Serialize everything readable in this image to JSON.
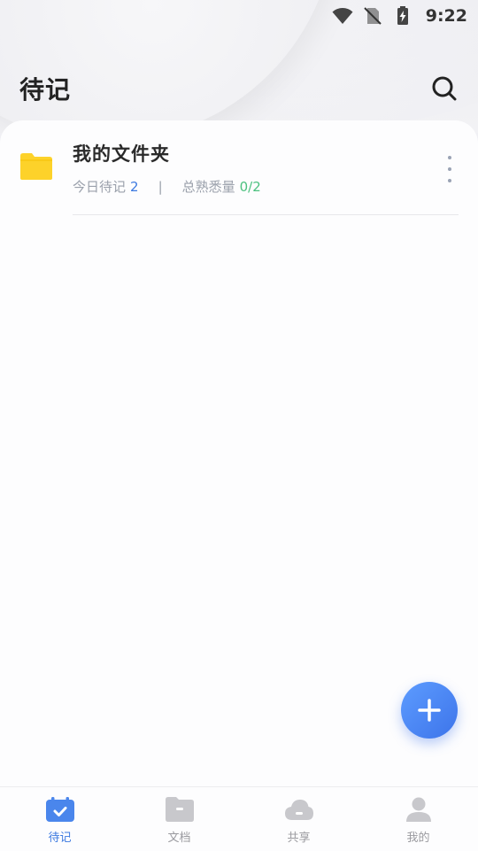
{
  "status_bar": {
    "time": "9:22"
  },
  "header": {
    "title": "待记"
  },
  "folder": {
    "name": "我的文件夹",
    "today_label": "今日待记",
    "today_count": "2",
    "divider": "|",
    "familiar_label": "总熟悉量",
    "familiar_count": "0/2"
  },
  "tabbar": {
    "items": [
      {
        "label": "待记",
        "icon": "calendar-check-icon",
        "active": true
      },
      {
        "label": "文档",
        "icon": "folder-icon",
        "active": false
      },
      {
        "label": "共享",
        "icon": "cloud-icon",
        "active": false
      },
      {
        "label": "我的",
        "icon": "user-icon",
        "active": false
      }
    ]
  },
  "colors": {
    "accent": "#3d7ae0",
    "success": "#4cc17f",
    "folder": "#fdd22a",
    "inactive": "#c8c8cc"
  }
}
